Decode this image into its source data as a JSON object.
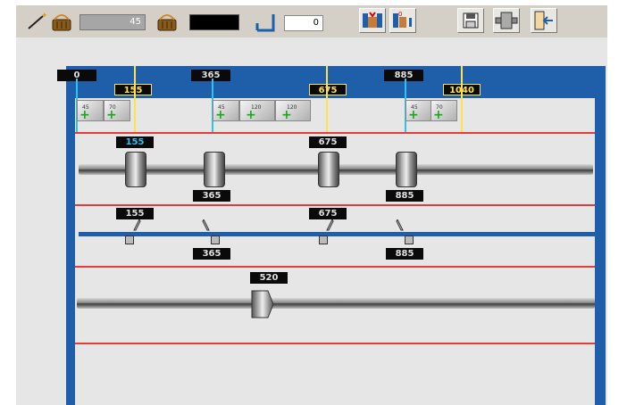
{
  "toolbar": {
    "counter_value": "45",
    "offset_value": "0"
  },
  "ruler": {
    "blue_marks": [
      "0",
      "365",
      "885"
    ],
    "yellow_marks": [
      "155",
      "675",
      "1040"
    ]
  },
  "blade_row": {
    "angles": [
      "45",
      "70",
      "45",
      "120",
      "120",
      "45",
      "70"
    ]
  },
  "top_shaft": {
    "upper_labels": [
      "155",
      "675"
    ],
    "lower_labels": [
      "365",
      "885"
    ]
  },
  "knife_row": {
    "upper_labels": [
      "155",
      "675"
    ],
    "lower_labels": [
      "365",
      "885"
    ]
  },
  "bottom_shaft": {
    "label": "520"
  },
  "colors": {
    "frame_blue": "#1f5faa",
    "limit_red": "#e83a3a",
    "marker_yellow": "#ffe14a",
    "marker_cyan": "#2fc1f0"
  }
}
